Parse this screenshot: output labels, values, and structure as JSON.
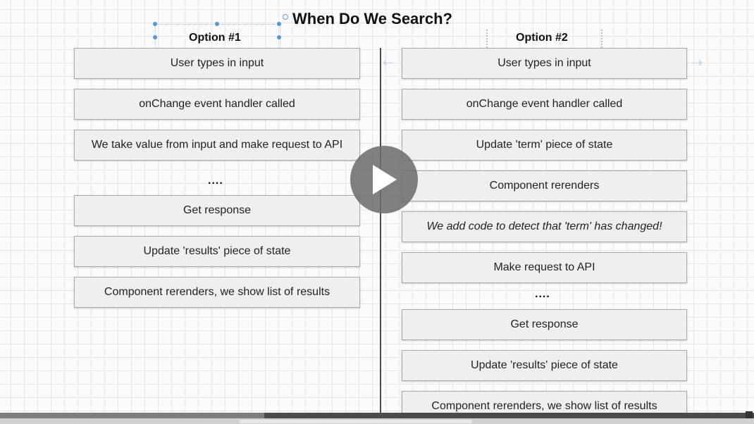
{
  "title": "When Do We Search?",
  "option1": {
    "heading": "Option #1",
    "steps": [
      "User types in input",
      "onChange event handler called",
      "We take value from input and make request to API",
      "....",
      "Get response",
      "Update 'results' piece of state",
      "Component rerenders, we show list of results"
    ]
  },
  "option2": {
    "heading": "Option #2",
    "steps": [
      "User types in input",
      "onChange event handler called",
      "Update 'term' piece of state",
      "Component rerenders",
      "We add code to detect that 'term' has changed!",
      "Make request to API",
      "....",
      "Get response",
      "Update 'results' piece of state",
      "Component rerenders, we show list of results"
    ]
  },
  "video": {
    "progress": 0.35
  }
}
